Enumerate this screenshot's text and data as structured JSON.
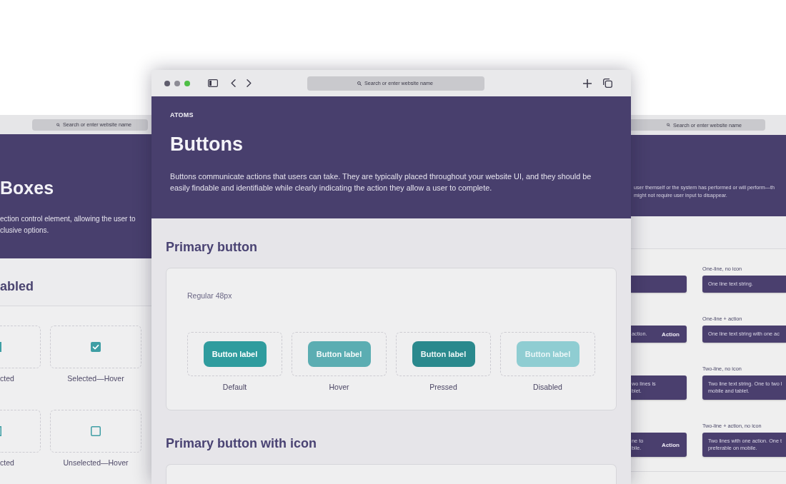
{
  "left_window": {
    "address_bar": {
      "placeholder": "Search or enter website name"
    },
    "header": {
      "title": "Boxes",
      "description_lines": [
        "ection control element, allowing the user to",
        "clusive options."
      ]
    },
    "section_title": "abled",
    "tiles": [
      {
        "caption": "cted",
        "checked": true
      },
      {
        "caption": "Selected—Hover",
        "checked": true
      },
      {
        "caption": "cted",
        "checked": false
      },
      {
        "caption": "Unselected—Hover",
        "checked": false
      }
    ]
  },
  "front_window": {
    "window_buttons": [
      {
        "color": "#5f5d6d"
      },
      {
        "color": "#8d8c95"
      },
      {
        "color": "#4fbf46"
      }
    ],
    "address_bar": {
      "placeholder": "Search or enter website name"
    },
    "header": {
      "eyebrow": "ATOMS",
      "title": "Buttons",
      "description": "Buttons communicate actions that users can take. They are typically placed throughout your website UI, and they should be easily findable and identifiable while clearly indicating the action they allow a user to complete."
    },
    "sections": [
      {
        "title": "Primary button",
        "card_label": "Regular 48px",
        "variants": [
          {
            "kind": "default",
            "label": "Button label",
            "caption": "Default"
          },
          {
            "kind": "hover",
            "label": "Button label",
            "caption": "Hover"
          },
          {
            "kind": "pressed",
            "label": "Button label",
            "caption": "Pressed"
          },
          {
            "kind": "disabled",
            "label": "Button label",
            "caption": "Disabled"
          }
        ]
      },
      {
        "title": "Primary button with icon"
      }
    ]
  },
  "right_window": {
    "address_bar": {
      "placeholder": "Search or enter website name"
    },
    "header": {
      "description_lines": [
        "user themself or the system has performed or will perform—th",
        "might not require user input to disappear."
      ]
    },
    "left_column": [
      {
        "kind": "one-line"
      },
      {
        "kind": "one-line",
        "text_lines": [
          "action."
        ],
        "action": "Action"
      },
      {
        "kind": "two-line",
        "text_lines": [
          "wo lines is",
          "blet."
        ]
      },
      {
        "kind": "two-line",
        "text_lines": [
          "ne to",
          "bile."
        ],
        "action": "Action"
      }
    ],
    "right_column": [
      {
        "label": "One-line, no icon",
        "kind": "one-line",
        "text_lines": [
          "One line text string."
        ]
      },
      {
        "label": "One-line + action",
        "kind": "one-line",
        "text_lines": [
          "One line text string with one ac"
        ]
      },
      {
        "label": "Two-line, no icon",
        "kind": "two-line",
        "text_lines": [
          "Two line text string. One to two l",
          "mobile and tablet."
        ]
      },
      {
        "label": "Two-line + action, no icon",
        "kind": "two-line",
        "text_lines": [
          "Two lines with one action. One t",
          "preferable on mobile."
        ]
      }
    ]
  }
}
